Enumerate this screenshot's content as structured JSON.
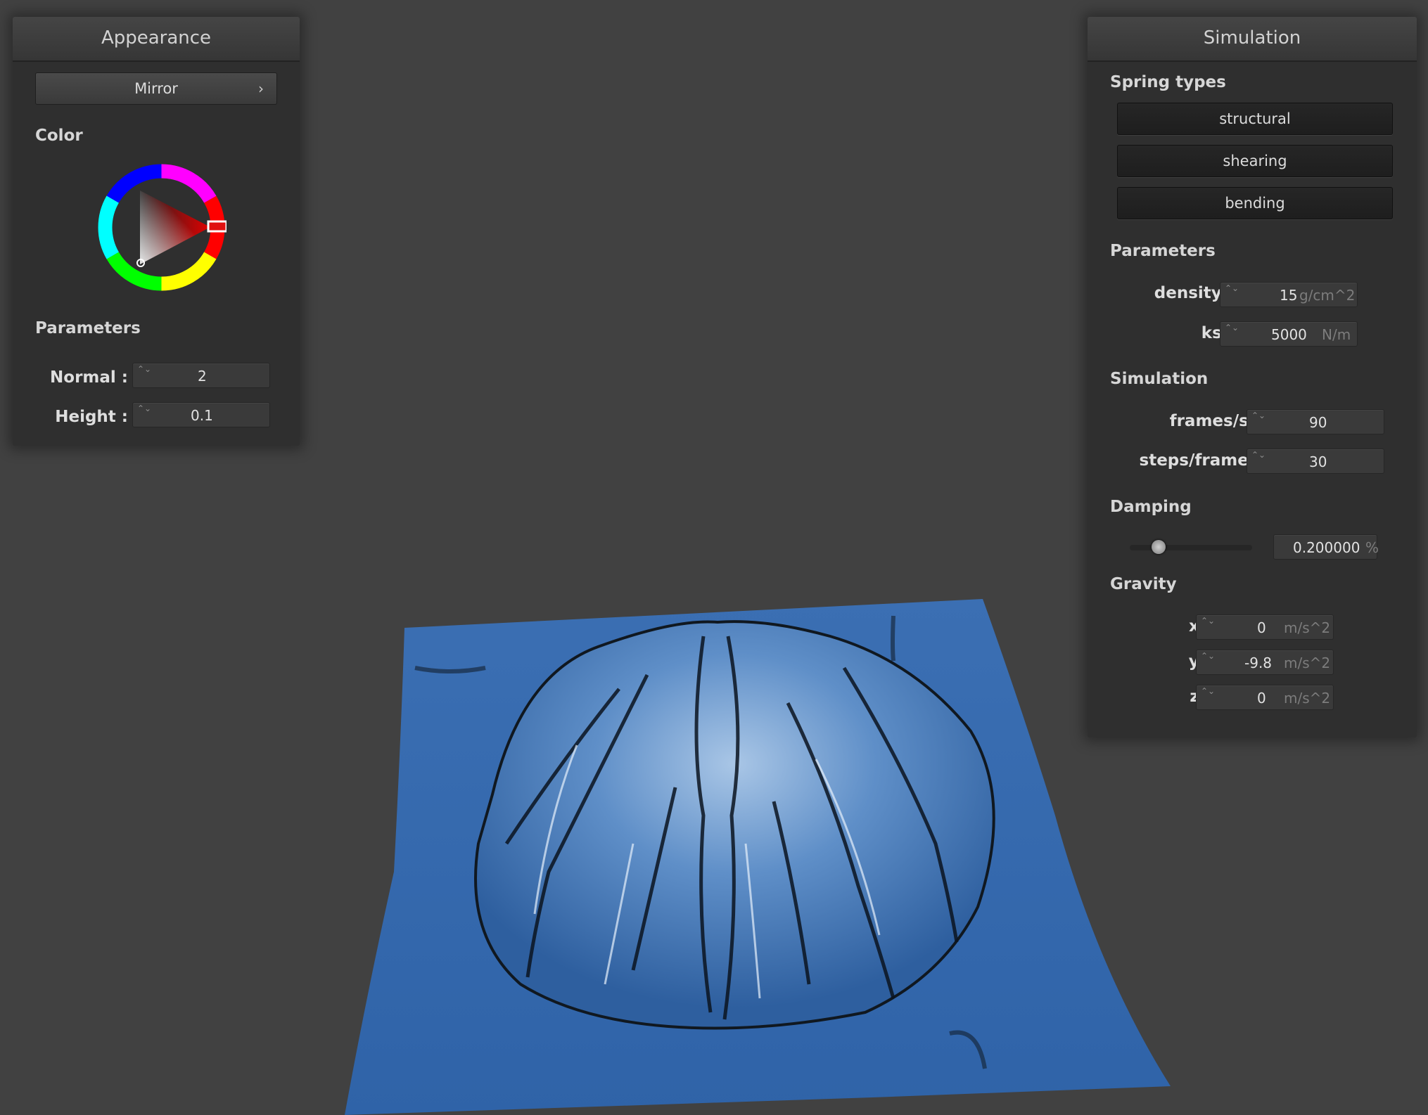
{
  "appearance": {
    "title": "Appearance",
    "shader_button": "Mirror",
    "chevron_glyph": "›",
    "color_title": "Color",
    "color_hue": "#ff0000",
    "params_title": "Parameters",
    "normal_label": "Normal :",
    "normal_value": "2",
    "height_label": "Height :",
    "height_value": "0.1"
  },
  "simulation_panel": {
    "title": "Simulation",
    "spring_types_title": "Spring types",
    "spring_buttons": [
      "structural",
      "shearing",
      "bending"
    ],
    "params_title": "Parameters",
    "density_label": "density :",
    "density_value": "15",
    "density_unit": "g/cm^2",
    "ks_label": "ks :",
    "ks_value": "5000",
    "ks_unit": "N/m",
    "sim_title": "Simulation",
    "fps_label": "frames/s :",
    "fps_value": "90",
    "steps_label": "steps/frame :",
    "steps_value": "30",
    "damping_title": "Damping",
    "damping_value": "0.200000",
    "damping_unit": "%",
    "damping_fraction": 0.2,
    "gravity_title": "Gravity",
    "gx_label": "x :",
    "gx_value": "0",
    "gy_label": "y :",
    "gy_value": "-9.8",
    "gz_label": "z :",
    "gz_value": "0",
    "gravity_unit": "m/s^2"
  },
  "spinner_glyph": "⌃⌄",
  "cloth_color": "#3d72b8"
}
